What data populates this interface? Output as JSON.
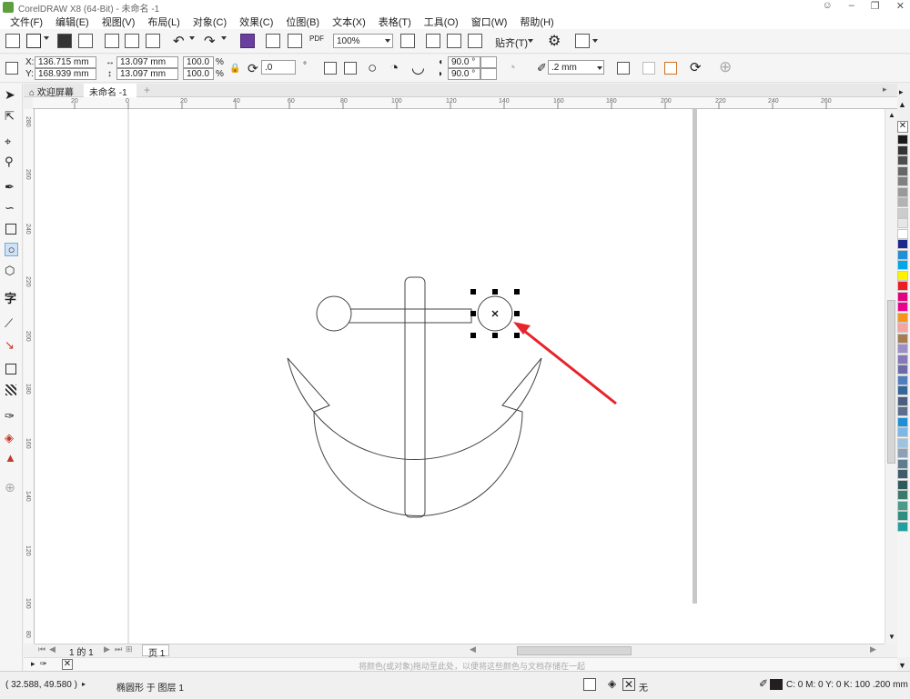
{
  "window": {
    "title": "CorelDRAW X8 (64-Bit) - 未命名 -1",
    "controls": [
      "minimize",
      "restore",
      "close"
    ]
  },
  "menu": [
    "文件(F)",
    "编辑(E)",
    "视图(V)",
    "布局(L)",
    "对象(C)",
    "效果(C)",
    "位图(B)",
    "文本(X)",
    "表格(T)",
    "工具(O)",
    "窗口(W)",
    "帮助(H)"
  ],
  "toolbar": {
    "zoom_value": "100%",
    "snap_label": "贴齐(T)",
    "pdf_label": "PDF"
  },
  "property_bar": {
    "x_label": "X:",
    "x_value": "136.715 mm",
    "y_label": "Y:",
    "y_value": "168.939 mm",
    "width_value": "13.097 mm",
    "height_value": "13.097 mm",
    "scale_x": "100.0",
    "scale_y": "100.0",
    "percent": "%",
    "rotation": ".0",
    "degree": "°",
    "start_angle": "90.0 °",
    "end_angle": "90.0 °",
    "outline_width": ".2 mm"
  },
  "doc_tabs": [
    {
      "label": "欢迎屏幕",
      "active": false
    },
    {
      "label": "未命名 -1",
      "active": true
    }
  ],
  "ruler": {
    "h_ticks": [
      "20",
      "0",
      "20",
      "40",
      "60",
      "80",
      "100",
      "120",
      "140",
      "160",
      "180",
      "200",
      "220",
      "240",
      "260"
    ],
    "v_ticks": [
      "280",
      "260",
      "240",
      "220",
      "200",
      "180",
      "160",
      "140",
      "120",
      "100",
      "80"
    ]
  },
  "page_nav": {
    "page_of": "1 的 1",
    "page_tab": "页 1"
  },
  "hint_text": "将颜色(或对象)拖动至此处，以便将这些颜色与文档存储在一起",
  "status": {
    "cursor_coords": "( 32.588, 49.580 )",
    "selection_info": "椭圆形 于 图层 1",
    "fill_label": "无",
    "outline_info": "C: 0 M: 0 Y: 0 K: 100  .200 mm"
  },
  "palette_colors": [
    "#1a1a1a",
    "#333333",
    "#4d4d4d",
    "#666666",
    "#808080",
    "#999999",
    "#b3b3b3",
    "#cccccc",
    "#e6e6e6",
    "#ffffff",
    "#1b2a8a",
    "#1e90d6",
    "#00a8e8",
    "#fff200",
    "#ed1c24",
    "#e4007f",
    "#ec008c",
    "#f7941d",
    "#f5a3a3",
    "#a67c52",
    "#9b8fc7",
    "#8579b8",
    "#6d6aa8",
    "#4f7fbf",
    "#336699",
    "#4a5f7f",
    "#5b6e8e",
    "#1e8fd6",
    "#7ab8e6",
    "#9ec3e0",
    "#8ca1b8",
    "#5d7d8f",
    "#3d5b6b",
    "#2d5a5a",
    "#3a7a6a",
    "#4a9a8a",
    "#2f8f7f",
    "#20a0a0"
  ],
  "accent": "#e8232a"
}
